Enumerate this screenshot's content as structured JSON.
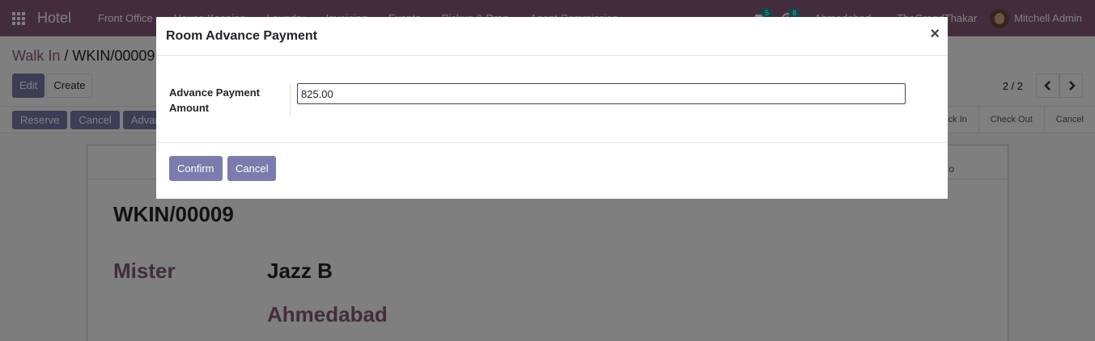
{
  "navbar": {
    "brand": "Hotel",
    "menu": [
      "Front Office",
      "House Keeping",
      "Laundry",
      "Invoicing",
      "Events",
      "Pickup & Drop",
      "Agent Commission"
    ],
    "chat_badge": "5",
    "activity_badge": "8",
    "company": "Ahmedabad",
    "website": "TheGrandThakar",
    "user": "Mitchell Admin"
  },
  "breadcrumb": {
    "parent": "Walk In",
    "separator": "/",
    "current": "WKIN/00009"
  },
  "control_panel": {
    "edit_label": "Edit",
    "create_label": "Create",
    "pager": "2 / 2"
  },
  "statusbar": {
    "buttons": [
      "Reserve",
      "Cancel",
      "Advance Payment"
    ],
    "stages": [
      "Check In",
      "Check Out",
      "Cancel"
    ]
  },
  "sheet": {
    "button_box_text": "o",
    "record_name": "WKIN/00009",
    "title": "Mister",
    "partner": "Jazz B",
    "city": "Ahmedabad"
  },
  "modal": {
    "title": "Room Advance Payment",
    "close_glyph": "×",
    "field_label": "Advance Payment Amount",
    "field_value": "825.00",
    "confirm_label": "Confirm",
    "cancel_label": "Cancel"
  },
  "colors": {
    "navbar": "#875a7b",
    "primary_button": "#7c7bad",
    "badge": "#00a09d"
  }
}
